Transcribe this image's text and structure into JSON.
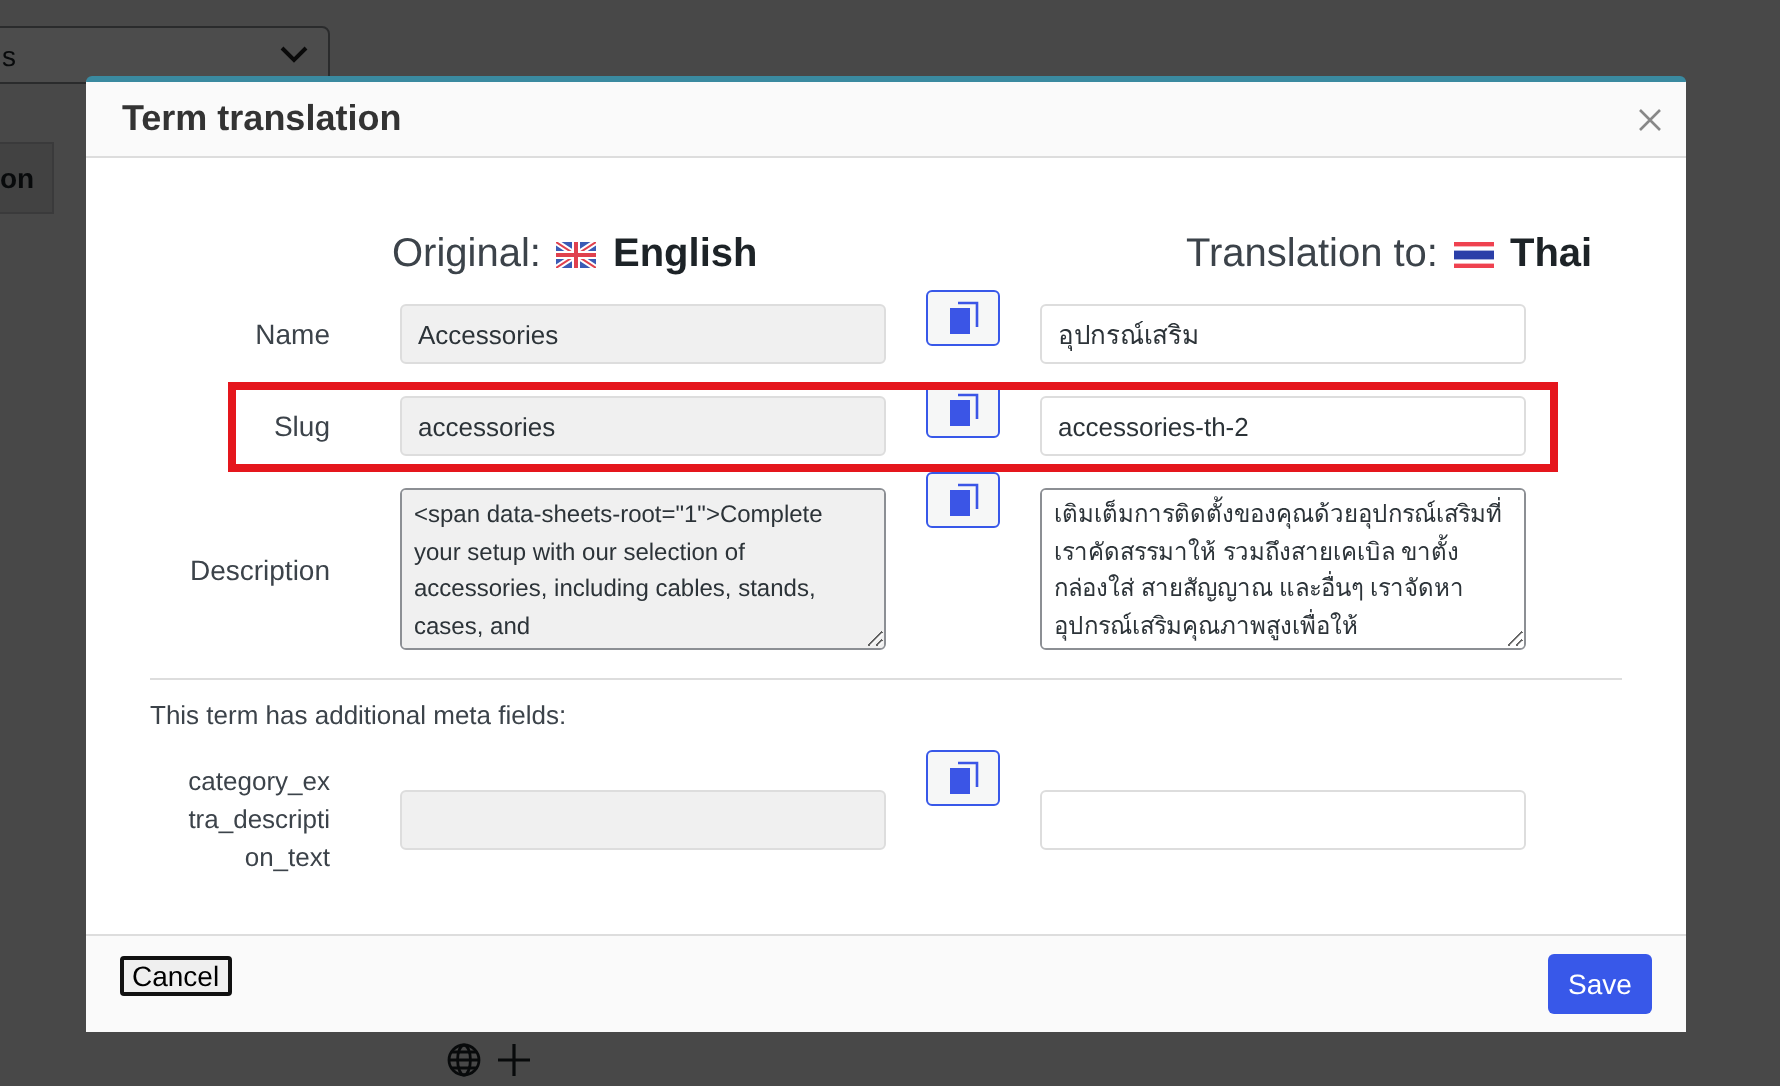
{
  "background": {
    "select_value": "s",
    "tab_label": "on"
  },
  "dialog": {
    "title": "Term translation",
    "columns": [
      {
        "prefix": "Original:",
        "kind": "uk",
        "language": "English"
      },
      {
        "prefix": "Translation to:",
        "kind": "th",
        "language": "Thai"
      }
    ],
    "fields": [
      {
        "label": "Name",
        "kind": "input",
        "original": "Accessories",
        "translation": "อุปกรณ์เสริม",
        "highlighted": false
      },
      {
        "label": "Slug",
        "kind": "input",
        "original": "accessories",
        "translation": "accessories-th-2",
        "highlighted": true
      },
      {
        "label": "Description",
        "kind": "textarea",
        "original": "<span data-sheets-root=\"1\">Complete your setup with our selection of accessories, including cables, stands, cases, and",
        "translation": "เติมเต็มการติดตั้งของคุณด้วยอุปกรณ์เสริมที่เราคัดสรรมาให้ รวมถึงสายเคเบิล ขาตั้ง กล่องใส่ สายสัญญาณ และอื่นๆ เราจัดหาอุปกรณ์เสริมคุณภาพสูงเพื่อให้",
        "highlighted": false
      }
    ],
    "meta_note": "This term has additional meta fields:",
    "meta_fields": [
      {
        "label": "category_extra_description_text"
      }
    ],
    "buttons": {
      "cancel": "Cancel",
      "save": "Save"
    }
  }
}
